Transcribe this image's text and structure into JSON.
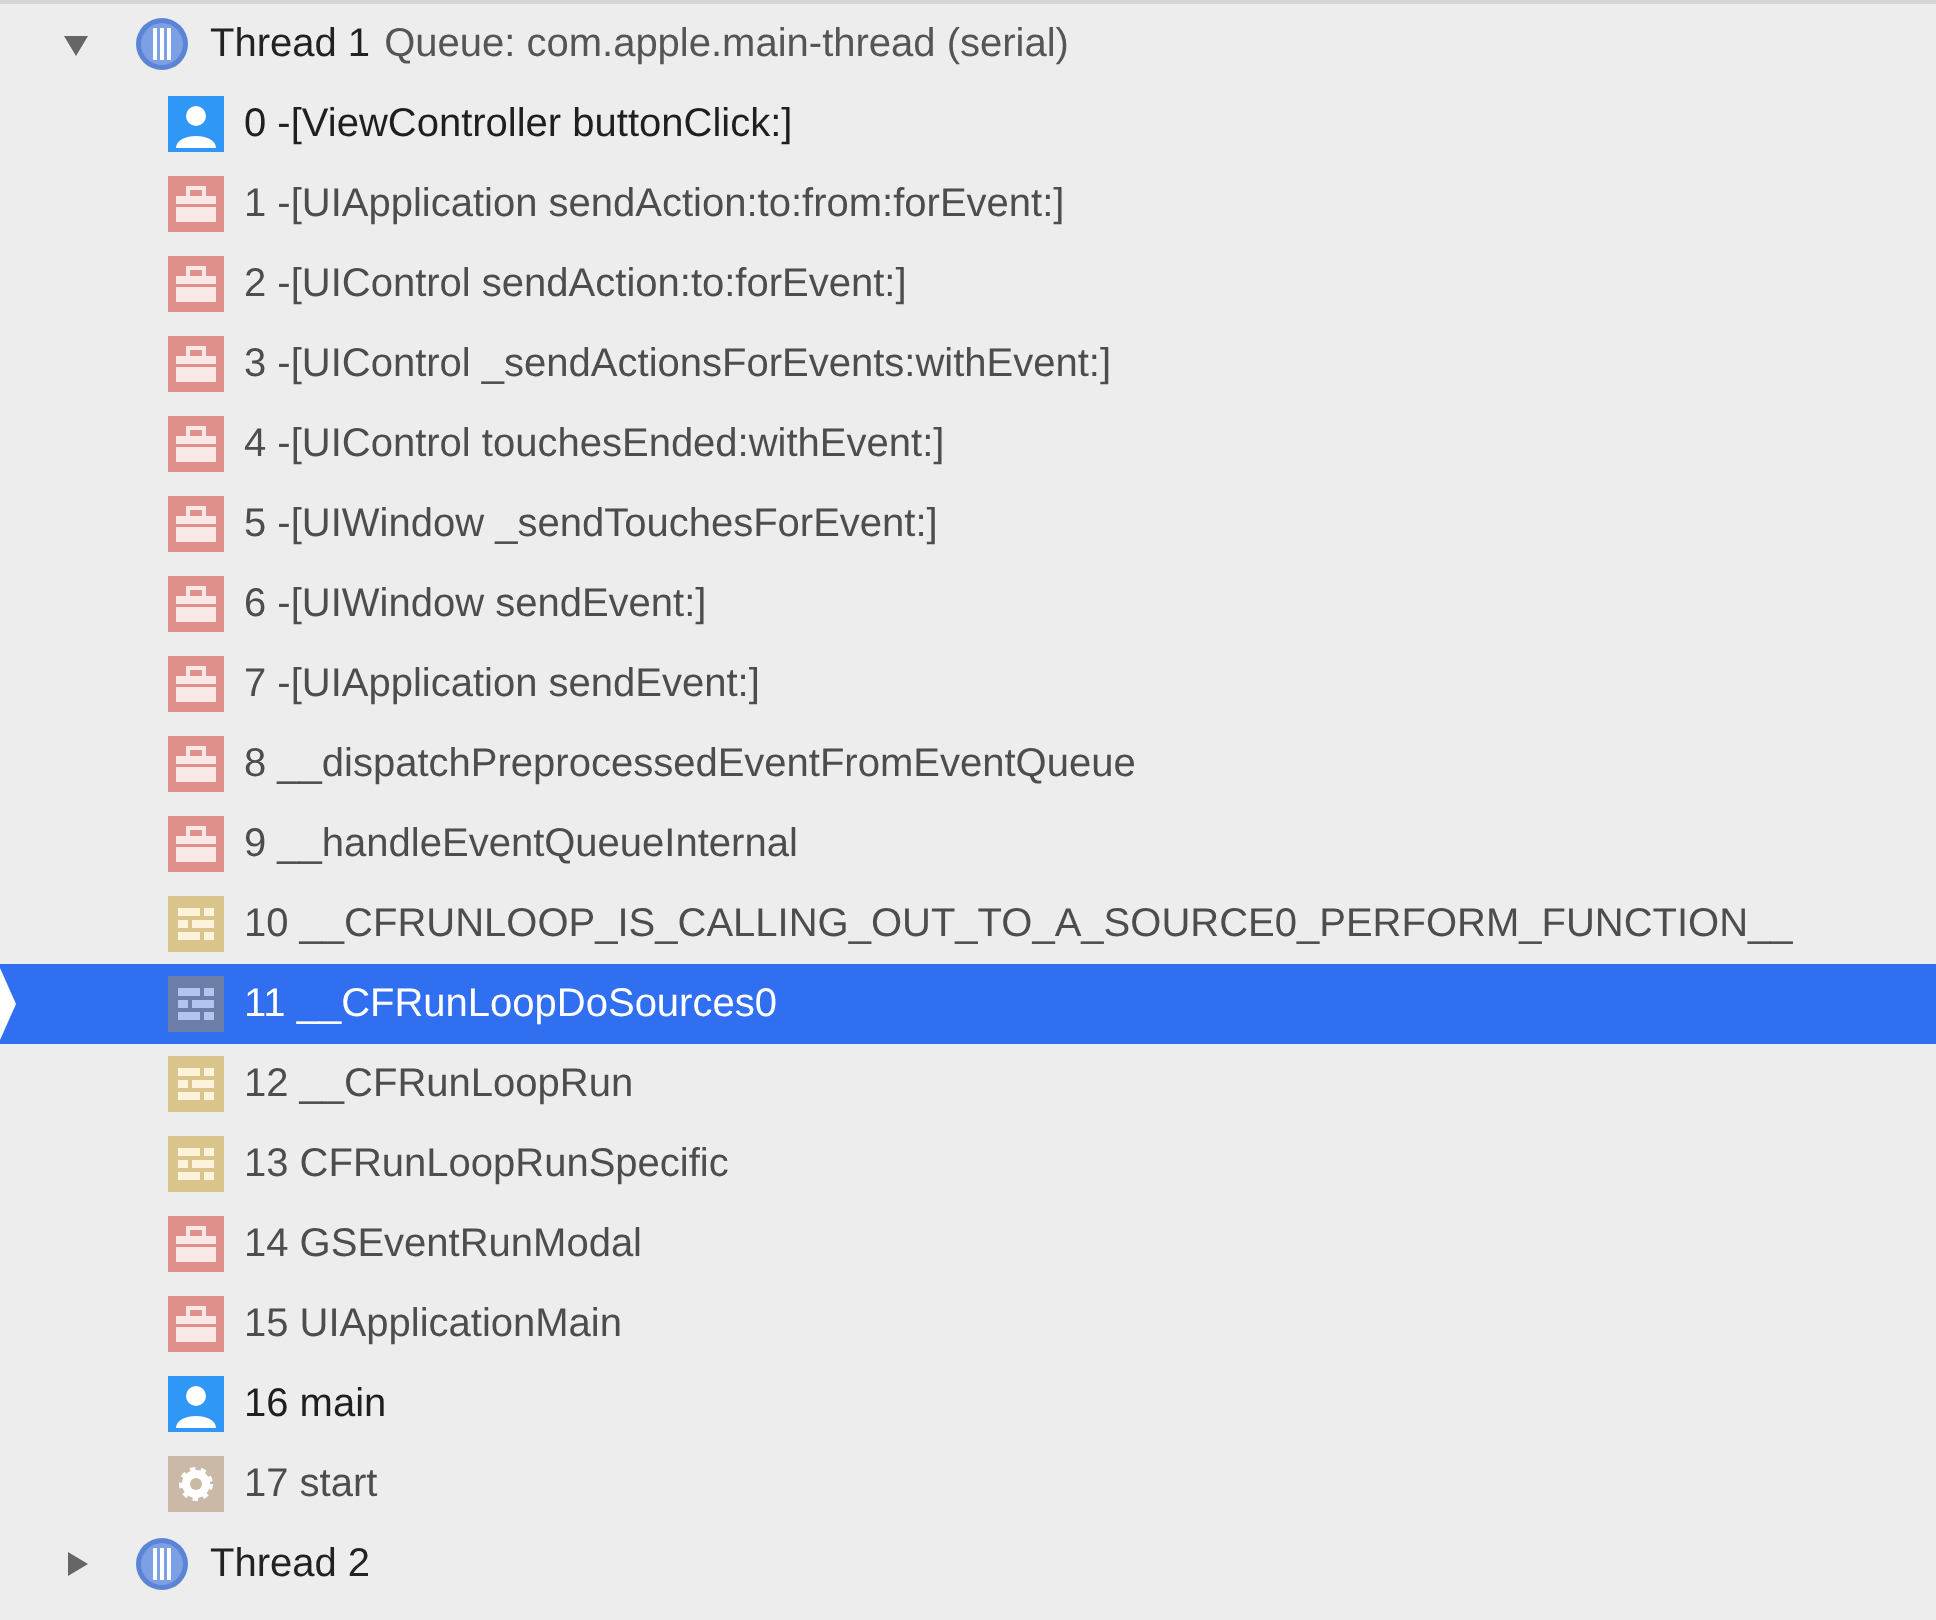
{
  "threads": [
    {
      "title": "Thread 1",
      "queue": "Queue: com.apple.main-thread (serial)",
      "expanded": true,
      "frames": [
        {
          "label": "0 -[ViewController buttonClick:]",
          "kind": "user",
          "selected": false
        },
        {
          "label": "1 -[UIApplication sendAction:to:from:forEvent:]",
          "kind": "framework",
          "selected": false
        },
        {
          "label": "2 -[UIControl sendAction:to:forEvent:]",
          "kind": "framework",
          "selected": false
        },
        {
          "label": "3 -[UIControl _sendActionsForEvents:withEvent:]",
          "kind": "framework",
          "selected": false
        },
        {
          "label": "4 -[UIControl touchesEnded:withEvent:]",
          "kind": "framework",
          "selected": false
        },
        {
          "label": "5 -[UIWindow _sendTouchesForEvent:]",
          "kind": "framework",
          "selected": false
        },
        {
          "label": "6 -[UIWindow sendEvent:]",
          "kind": "framework",
          "selected": false
        },
        {
          "label": "7 -[UIApplication sendEvent:]",
          "kind": "framework",
          "selected": false
        },
        {
          "label": "8 __dispatchPreprocessedEventFromEventQueue",
          "kind": "framework",
          "selected": false
        },
        {
          "label": "9 __handleEventQueueInternal",
          "kind": "framework",
          "selected": false
        },
        {
          "label": "10 __CFRUNLOOP_IS_CALLING_OUT_TO_A_SOURCE0_PERFORM_FUNCTION__",
          "kind": "corefoundation",
          "selected": false
        },
        {
          "label": "11 __CFRunLoopDoSources0",
          "kind": "corefoundation",
          "selected": true
        },
        {
          "label": "12 __CFRunLoopRun",
          "kind": "corefoundation",
          "selected": false
        },
        {
          "label": "13 CFRunLoopRunSpecific",
          "kind": "corefoundation",
          "selected": false
        },
        {
          "label": "14 GSEventRunModal",
          "kind": "framework",
          "selected": false
        },
        {
          "label": "15 UIApplicationMain",
          "kind": "framework",
          "selected": false
        },
        {
          "label": "16 main",
          "kind": "user",
          "selected": false
        },
        {
          "label": "17 start",
          "kind": "system",
          "selected": false
        }
      ]
    },
    {
      "title": "Thread 2",
      "expanded": false
    }
  ]
}
